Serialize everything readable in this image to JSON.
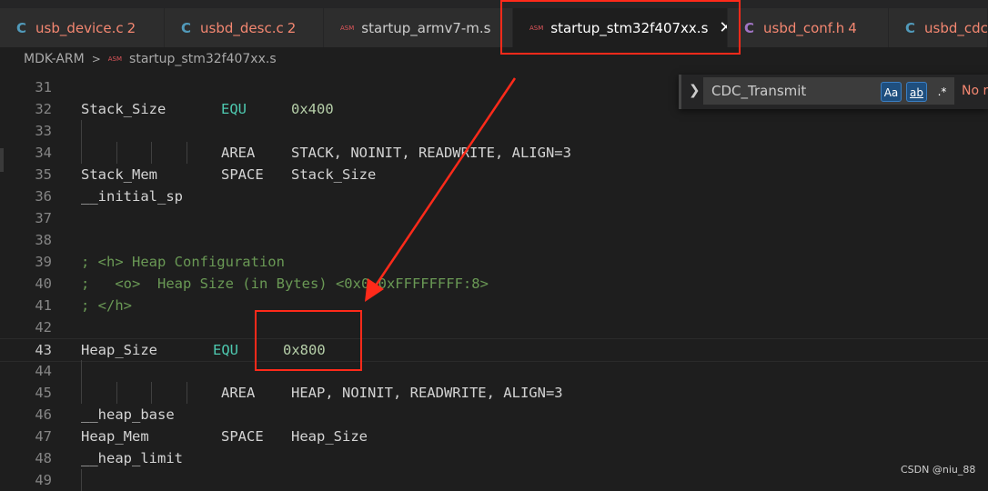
{
  "tabs": [
    {
      "icon": "C",
      "label": "usb_device.c",
      "count": "2"
    },
    {
      "icon": "C",
      "label": "usbd_desc.c",
      "count": "2"
    },
    {
      "icon": "ASM",
      "label": "startup_armv7-m.s",
      "count": ""
    },
    {
      "icon": "ASM",
      "label": "startup_stm32f407xx.s",
      "count": "",
      "close": "✕"
    },
    {
      "icon": "C",
      "label": "usbd_conf.h",
      "count": "4"
    },
    {
      "icon": "C",
      "label": "usbd_cdc_",
      "count": ""
    }
  ],
  "breadcrumb": {
    "folder": "MDK-ARM",
    "sep": ">",
    "file_icon": "ASM",
    "file": "startup_stm32f407xx.s"
  },
  "find": {
    "value": "CDC_Transmit",
    "match_case": "Aa",
    "whole_word": "ab",
    "regex": ".*",
    "status": "No re"
  },
  "lines": [
    {
      "n": "31"
    },
    {
      "n": "32",
      "a": "Stack_Size",
      "b": "EQU",
      "c": "0x400"
    },
    {
      "n": "33"
    },
    {
      "n": "34",
      "b2": "AREA",
      "c2": "STACK, NOINIT, READWRITE, ALIGN=3"
    },
    {
      "n": "35",
      "a": "Stack_Mem",
      "b2": "SPACE",
      "c2": "Stack_Size"
    },
    {
      "n": "36",
      "a": "__initial_sp"
    },
    {
      "n": "37"
    },
    {
      "n": "38"
    },
    {
      "n": "39",
      "cm": "; <h> Heap Configuration"
    },
    {
      "n": "40",
      "cm": ";   <o>  Heap Size (in Bytes) <0x0-0xFFFFFFFF:8>"
    },
    {
      "n": "41",
      "cm": "; </h>"
    },
    {
      "n": "42"
    },
    {
      "n": "43",
      "a": "Heap_Size",
      "b": "EQU",
      "c": "0x800"
    },
    {
      "n": "44"
    },
    {
      "n": "45",
      "b2": "AREA",
      "c2": "HEAP, NOINIT, READWRITE, ALIGN=3"
    },
    {
      "n": "46",
      "a": "__heap_base"
    },
    {
      "n": "47",
      "a": "Heap_Mem",
      "b2": "SPACE",
      "c2": "Heap_Size"
    },
    {
      "n": "48",
      "a": "__heap_limit"
    },
    {
      "n": "49"
    }
  ],
  "watermark": "CSDN @niu_88"
}
